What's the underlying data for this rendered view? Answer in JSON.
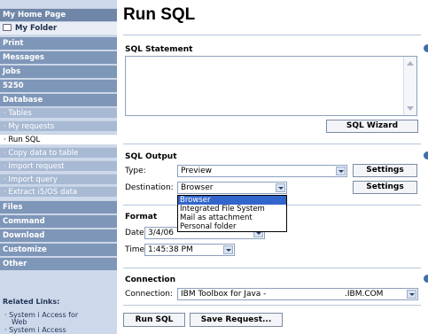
{
  "sidebar": {
    "home": "My Home Page",
    "folder": "My Folder",
    "print": "Print",
    "messages": "Messages",
    "jobs": "Jobs",
    "s5250": "5250",
    "database": "Database",
    "tables": "· Tables",
    "my_requests": "· My requests",
    "run_sql": "· Run SQL",
    "copy_data": "· Copy data to table",
    "import_request": "· Import request",
    "import_query": "· Import query",
    "extract": "· Extract i5/OS data",
    "files": "Files",
    "command": "Command",
    "download": "Download",
    "customize": "Customize",
    "other": "Other",
    "related_title": "Related Links:",
    "related_1a": "· System i Access for",
    "related_1b": "Web",
    "related_2": "· System i Access"
  },
  "main": {
    "title": "Run SQL",
    "sql_statement": "SQL Statement",
    "sql_wizard": "SQL Wizard",
    "sql_output": "SQL Output",
    "type_label": "Type:",
    "type_value": "Preview",
    "settings": "Settings",
    "destination_label": "Destination:",
    "destination_value": "Browser",
    "format": "Format",
    "date_label": "Date:",
    "date_value": "3/4/06",
    "time_label": "Time:",
    "time_value": "1:45:38 PM",
    "connection": "Connection",
    "connection_label": "Connection:",
    "connection_value": "IBM Toolbox for Java -",
    "connection_suffix": ".IBM.COM",
    "run_sql": "Run SQL",
    "save_request": "Save Request..."
  },
  "dropdown": {
    "options": [
      "Browser",
      "Integrated File System",
      "Mail as attachment",
      "Personal folder"
    ],
    "selected": 0
  }
}
